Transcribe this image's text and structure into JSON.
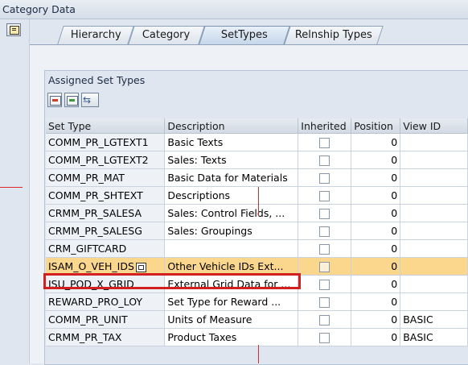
{
  "window": {
    "title": "Category Data"
  },
  "tabs": [
    {
      "label": "Hierarchy",
      "active": false
    },
    {
      "label": "Category",
      "active": false
    },
    {
      "label": "SetTypes",
      "active": true
    },
    {
      "label": "Relnship Types",
      "active": false
    }
  ],
  "panel": {
    "title": "Assigned Set Types",
    "toolbar": [
      {
        "icon": "delete-row-icon"
      },
      {
        "icon": "insert-row-icon"
      },
      {
        "icon": "transfer-icon"
      }
    ]
  },
  "table": {
    "columns": [
      "Set Type",
      "Description",
      "Inherited",
      "Position",
      "View ID"
    ],
    "rows": [
      {
        "set_type": "COMM_PR_LGTEXT1",
        "description": "Basic Texts",
        "inherited": false,
        "position": "0",
        "view_id": ""
      },
      {
        "set_type": "COMM_PR_LGTEXT2",
        "description": "Sales: Texts",
        "inherited": false,
        "position": "0",
        "view_id": ""
      },
      {
        "set_type": "COMM_PR_MAT",
        "description": "Basic Data for Materials",
        "inherited": false,
        "position": "0",
        "view_id": ""
      },
      {
        "set_type": "COMM_PR_SHTEXT",
        "description": "Descriptions",
        "inherited": false,
        "position": "0",
        "view_id": ""
      },
      {
        "set_type": "CRMM_PR_SALESA",
        "description": "Sales: Control Fields, ...",
        "inherited": false,
        "position": "0",
        "view_id": ""
      },
      {
        "set_type": "CRMM_PR_SALESG",
        "description": "Sales: Groupings",
        "inherited": false,
        "position": "0",
        "view_id": ""
      },
      {
        "set_type": "CRM_GIFTCARD",
        "description": "",
        "inherited": false,
        "position": "0",
        "view_id": ""
      },
      {
        "set_type": "ISAM_O_VEH_IDS",
        "description": "Other Vehicle IDs Ext...",
        "inherited": false,
        "position": "0",
        "view_id": ""
      },
      {
        "set_type": "ISU_POD_X_GRID",
        "description": "External Grid Data for ...",
        "inherited": false,
        "position": "0",
        "view_id": ""
      },
      {
        "set_type": "REWARD_PRO_LOY",
        "description": "Set Type for Reward ...",
        "inherited": false,
        "position": "0",
        "view_id": ""
      },
      {
        "set_type": "COMM_PR_UNIT",
        "description": "Units of Measure",
        "inherited": false,
        "position": "0",
        "view_id": "BASIC"
      },
      {
        "set_type": "CRMM_PR_TAX",
        "description": "Product Taxes",
        "inherited": false,
        "position": "0",
        "view_id": "BASIC"
      }
    ],
    "highlighted_row": 7
  },
  "colors": {
    "highlight": "#fad78d",
    "annotation": "#d21f1f"
  }
}
